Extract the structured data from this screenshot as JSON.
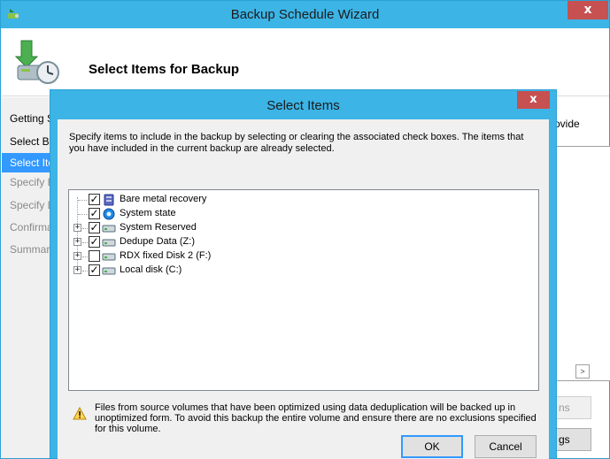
{
  "outer_window": {
    "title": "Backup Schedule Wizard",
    "close_glyph": "x",
    "header_title": "Select Items for Backup"
  },
  "nav": {
    "items": [
      {
        "label": "Getting Started",
        "state": "normal"
      },
      {
        "label": "Select Backup Configuration",
        "state": "normal"
      },
      {
        "label": "Select Items for Backup",
        "state": "active"
      },
      {
        "label": "Specify Backup Time",
        "state": "dim"
      },
      {
        "label": "Specify Destination Type",
        "state": "dim"
      },
      {
        "label": "Confirmation",
        "state": "dim"
      },
      {
        "label": "Summary",
        "state": "dim"
      }
    ]
  },
  "main": {
    "desc_fragment": "ovide",
    "scroll_right_glyph": ">",
    "button1_fragment": "ns",
    "button2_fragment": "gs"
  },
  "dialog": {
    "title": "Select Items",
    "close_glyph": "x",
    "description": "Specify items to include in the backup by selecting or clearing the associated check boxes. The items that you have included in the current backup are already selected.",
    "items": [
      {
        "label": "Bare metal recovery",
        "checked": true,
        "expandable": false,
        "icon": "bare-metal-icon"
      },
      {
        "label": "System state",
        "checked": true,
        "expandable": false,
        "icon": "system-state-icon"
      },
      {
        "label": "System Reserved",
        "checked": true,
        "expandable": true,
        "icon": "drive-icon"
      },
      {
        "label": "Dedupe Data (Z:)",
        "checked": true,
        "expandable": true,
        "icon": "drive-icon"
      },
      {
        "label": "RDX fixed Disk 2 (F:)",
        "checked": false,
        "expandable": true,
        "icon": "drive-icon"
      },
      {
        "label": "Local disk (C:)",
        "checked": true,
        "expandable": true,
        "icon": "drive-icon"
      }
    ],
    "warning": "Files from source volumes that have been optimized using data deduplication will be backed up in unoptimized form. To avoid this backup the entire volume and ensure there are no exclusions specified for this volume.",
    "ok_label": "OK",
    "cancel_label": "Cancel",
    "check_glyph": "✓",
    "expand_glyph": "+"
  },
  "colors": {
    "titlebar": "#3cb4e6",
    "close": "#c75050",
    "nav_active": "#3399ff"
  }
}
